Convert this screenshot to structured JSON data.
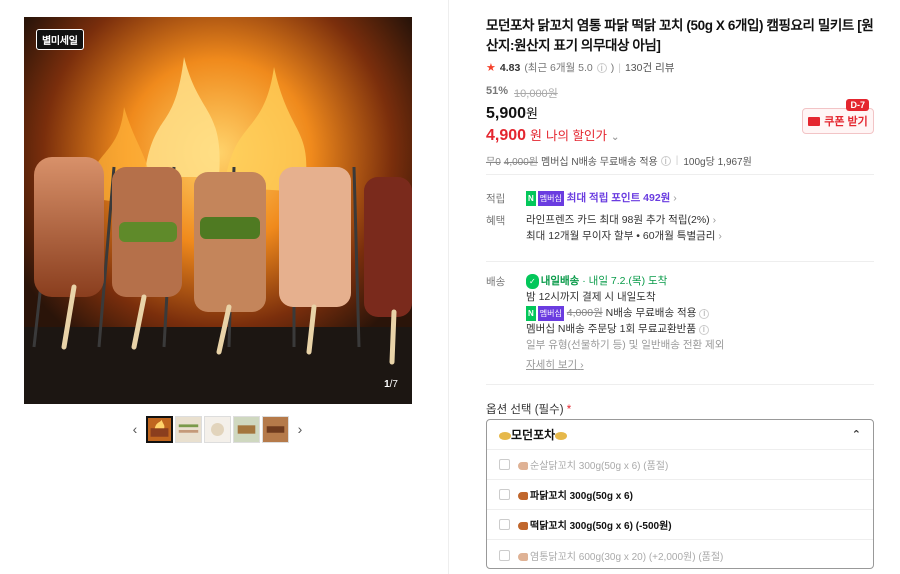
{
  "gallery": {
    "badge": "별미세일",
    "counter_current": "1",
    "counter_total": "/7",
    "prev_glyph": "‹",
    "next_glyph": "›"
  },
  "product": {
    "title": "모던포차 닭꼬치 염통 파닭 떡닭 꼬치 (50g X 6개입) 캠핑요리 밀키트 [원산지:원산지 표기 의무대상 아님]",
    "rating": "4.83",
    "rating_sub": "(최근 6개월 5.0",
    "reviews": "130건 리뷰"
  },
  "price": {
    "discount_pct": "51%",
    "original": "10,000원",
    "sale": "5,900",
    "sale_unit": "원",
    "my_price": "4,900",
    "my_price_unit": "원",
    "my_price_label": "나의 할인가",
    "coupon_label": "쿠폰 받기",
    "coupon_dday": "D-7"
  },
  "shipping_line": {
    "free_mark": "무0",
    "strike": "4,000원",
    "text": "멤버십 N배송 무료배송 적용",
    "unit_price": "100g당 1,967원"
  },
  "benefits": {
    "points_label": "적립",
    "points_text": "최대 적립 포인트 492원",
    "np_badge_n": "N",
    "np_badge_m": "멤버십",
    "card_label": "혜택",
    "card_line1": "라인프렌즈 카드 최대 98원 추가 적립(2%)",
    "card_line2": "최대 12개월 무이자 할부 • 60개월 특별금리"
  },
  "delivery": {
    "label": "배송",
    "tag": "내일배송",
    "arrival": "· 내일 7.2.(목) 도착",
    "line2": "밤 12시까지 결제 시 내일도착",
    "n_strike": "4,000원",
    "n_text": "N배송 무료배송 적용",
    "line4": "멤버십 N배송 주문당 1회 무료교환반품",
    "line5": "일부 유형(선물하기 등) 및 일반배송 전환 제외",
    "more": "자세히 보기"
  },
  "options": {
    "title": "옵션 선택 (필수)",
    "required_mark": "*",
    "selected": "모던포차",
    "items": [
      {
        "label": "순살닭꼬치 300g(50g x 6) (품절)",
        "state": "disabled"
      },
      {
        "label": "파닭꼬치 300g(50g x 6)",
        "state": "on"
      },
      {
        "label": "떡닭꼬치 300g(50g x 6) (-500원)",
        "state": "on"
      },
      {
        "label": "염통닭꼬치 600g(30g x 20) (+2,000원) (품절)",
        "state": "disabled"
      }
    ]
  },
  "colors": {
    "accent_red": "#e4262f",
    "naver_green": "#03c75a",
    "membership_purple": "#6a3ce0"
  }
}
